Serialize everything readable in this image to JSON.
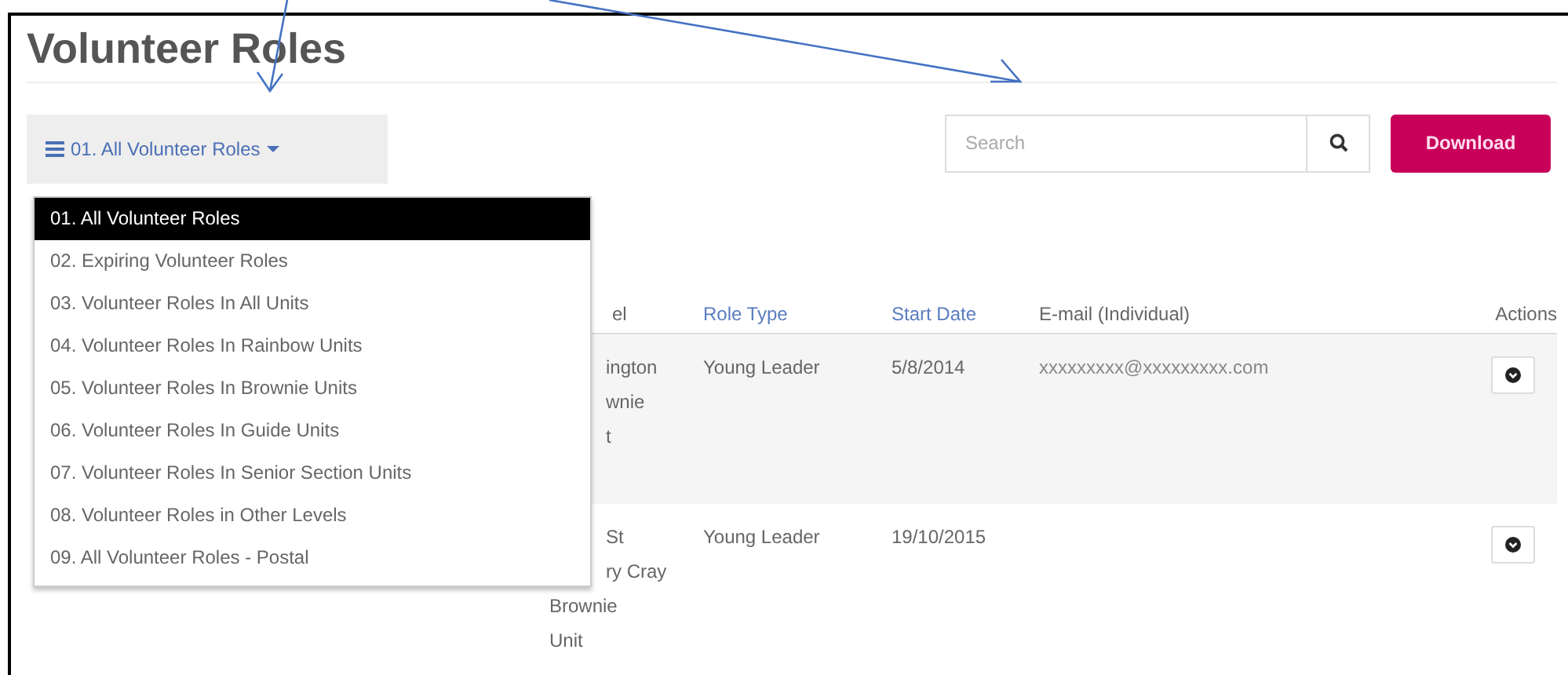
{
  "title": "Volunteer Roles",
  "filter": {
    "label": "01. All Volunteer Roles",
    "expanded": true,
    "options": [
      {
        "label": "01. All Volunteer Roles",
        "selected": true
      },
      {
        "label": "02. Expiring Volunteer Roles",
        "selected": false
      },
      {
        "label": "03. Volunteer Roles In All Units",
        "selected": false
      },
      {
        "label": "04. Volunteer Roles In Rainbow Units",
        "selected": false
      },
      {
        "label": "05. Volunteer Roles In Brownie Units",
        "selected": false
      },
      {
        "label": "06. Volunteer Roles In Guide Units",
        "selected": false
      },
      {
        "label": "07. Volunteer Roles In Senior Section Units",
        "selected": false
      },
      {
        "label": "08. Volunteer Roles in Other Levels",
        "selected": false
      },
      {
        "label": "09. All Volunteer Roles - Postal",
        "selected": false
      }
    ]
  },
  "search": {
    "placeholder": "Search"
  },
  "download_button": "Download",
  "table": {
    "columns": [
      {
        "label": "el",
        "sortable": false
      },
      {
        "label": "Role Type",
        "sortable": true
      },
      {
        "label": "Start Date",
        "sortable": true
      },
      {
        "label": "E-mail (Individual)",
        "sortable": false
      },
      {
        "label": "Actions",
        "sortable": false
      }
    ],
    "rows": [
      {
        "highlighted": true,
        "level_lines": [
          {
            "text": "ington",
            "covered": true
          },
          {
            "text": "wnie",
            "covered": true
          },
          {
            "text": "t",
            "covered": true
          }
        ],
        "role_type": "Young Leader",
        "start_date": "5/8/2014",
        "email": "xxxxxxxxx@xxxxxxxxx.com"
      },
      {
        "highlighted": false,
        "level_lines": [
          {
            "text": "St",
            "covered": true
          },
          {
            "text": "ry Cray",
            "covered": true
          },
          {
            "text": "Brownie",
            "covered": false
          },
          {
            "text": "Unit",
            "covered": false
          }
        ],
        "role_type": "Young Leader",
        "start_date": "19/10/2015",
        "email": null
      }
    ]
  }
}
